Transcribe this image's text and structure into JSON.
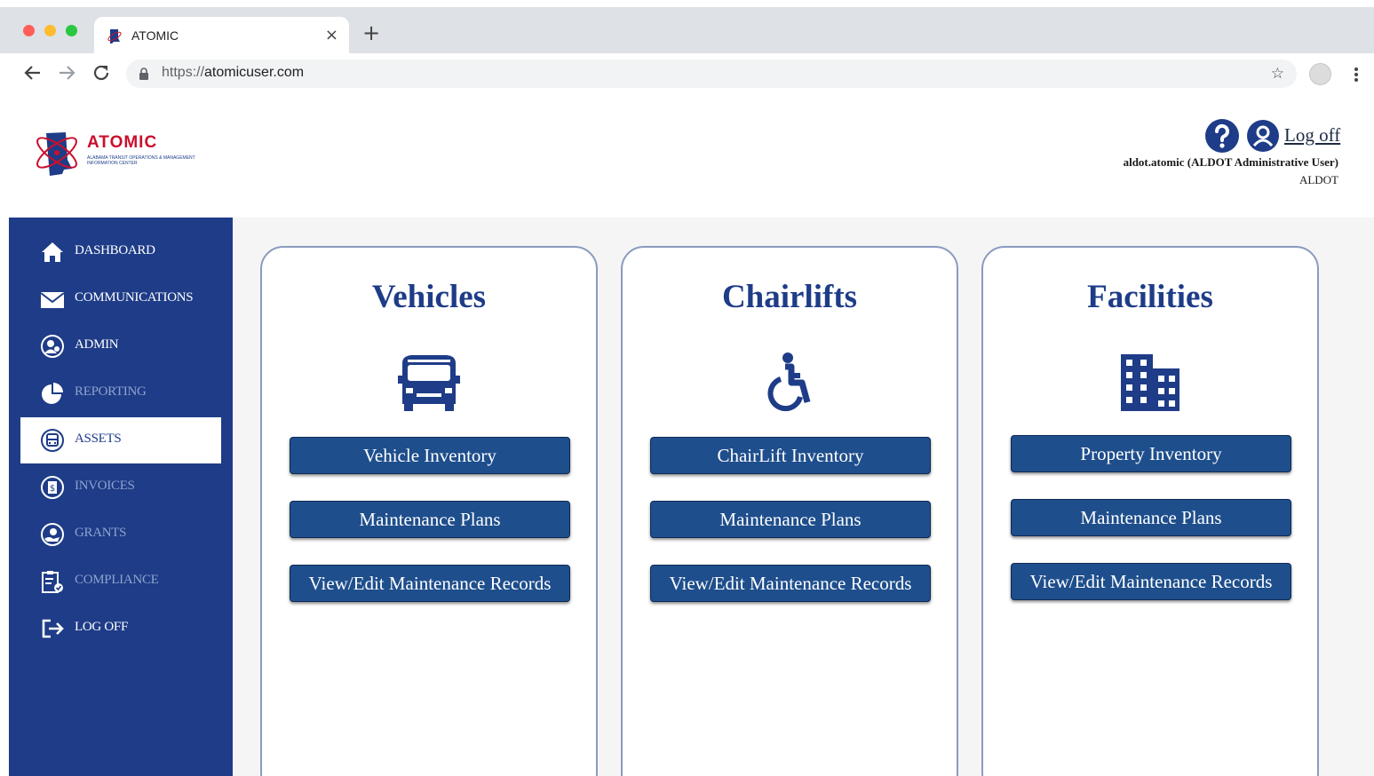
{
  "browser": {
    "tab_title": "ATOMIC",
    "url_scheme": "https://",
    "url_host": "atomicuser.com"
  },
  "header": {
    "logo_text": "ATOMIC",
    "logo_subtitle": "Alabama Transit Operations & Management Information Center",
    "logoff_label": "Log off",
    "user_name": "aldot.atomic (ALDOT Administrative User)",
    "user_org": "ALDOT"
  },
  "sidebar": {
    "items": [
      {
        "label": "DASHBOARD",
        "icon": "home-icon",
        "state": "normal"
      },
      {
        "label": "COMMUNICATIONS",
        "icon": "envelope-icon",
        "state": "normal"
      },
      {
        "label": "ADMIN",
        "icon": "admin-user-icon",
        "state": "normal"
      },
      {
        "label": "REPORTING",
        "icon": "pie-chart-icon",
        "state": "dimmed"
      },
      {
        "label": "ASSETS",
        "icon": "bus-icon",
        "state": "active"
      },
      {
        "label": "INVOICES",
        "icon": "invoice-icon",
        "state": "dimmed"
      },
      {
        "label": "GRANTS",
        "icon": "grant-icon",
        "state": "dimmed"
      },
      {
        "label": "COMPLIANCE",
        "icon": "clipboard-check-icon",
        "state": "dimmed"
      },
      {
        "label": "LOG OFF",
        "icon": "logout-icon",
        "state": "normal"
      }
    ]
  },
  "cards": [
    {
      "title": "Vehicles",
      "icon": "van-icon",
      "buttons": [
        "Vehicle Inventory",
        "Maintenance Plans",
        "View/Edit Maintenance Records"
      ]
    },
    {
      "title": "Chairlifts",
      "icon": "wheelchair-icon",
      "buttons": [
        "ChairLift Inventory",
        "Maintenance Plans",
        "View/Edit Maintenance Records"
      ]
    },
    {
      "title": "Facilities",
      "icon": "building-icon",
      "buttons": [
        "Property Inventory",
        "Maintenance Plans",
        "View/Edit Maintenance Records"
      ]
    }
  ],
  "colors": {
    "brand_navy": "#1e3c87",
    "button_blue": "#1e4e8c",
    "logo_red": "#c8102e",
    "dim_text": "#8fa3cf"
  }
}
